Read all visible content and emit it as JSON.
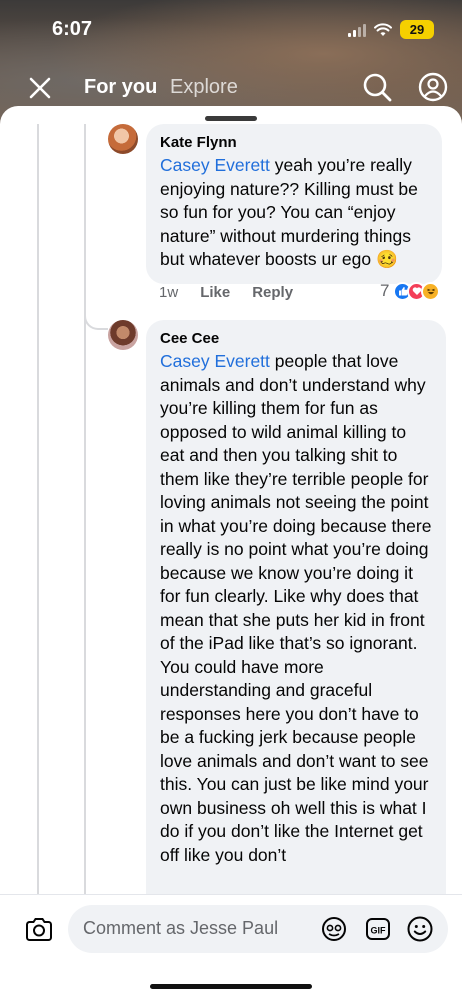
{
  "status_bar": {
    "time": "6:07",
    "battery": "29"
  },
  "nav": {
    "tab_for_you": "For you",
    "tab_explore": "Explore"
  },
  "comments": [
    {
      "author": "Kate Flynn",
      "mention": "Casey Everett",
      "text": " yeah you’re really enjoying nature?? Killing must be so fun for you? You can “enjoy nature” without murdering things but whatever boosts ur ego 🥴",
      "time": "1w",
      "like_label": "Like",
      "reply_label": "Reply",
      "reaction_count": "7",
      "reactions": [
        "like",
        "love",
        "haha"
      ]
    },
    {
      "author": "Cee Cee",
      "mention": "Casey Everett",
      "text": " people that love animals and don’t understand why you’re killing them for fun as opposed to wild animal killing to eat and then you talking shit to them like they’re terrible people for loving animals not seeing the point in what you’re doing because there really is no point what you’re doing because we know you’re doing it for fun clearly. Like why does that mean that she puts her kid in front of the iPad like that’s so ignorant. You could have more understanding and graceful responses here you don’t have to be a fucking jerk because people love animals and don’t want to see this. You can just be like mind your own business oh well this is what I do if you don’t like the Internet get off like you don’t"
    }
  ],
  "composer": {
    "placeholder": "Comment as Jesse Paul"
  }
}
